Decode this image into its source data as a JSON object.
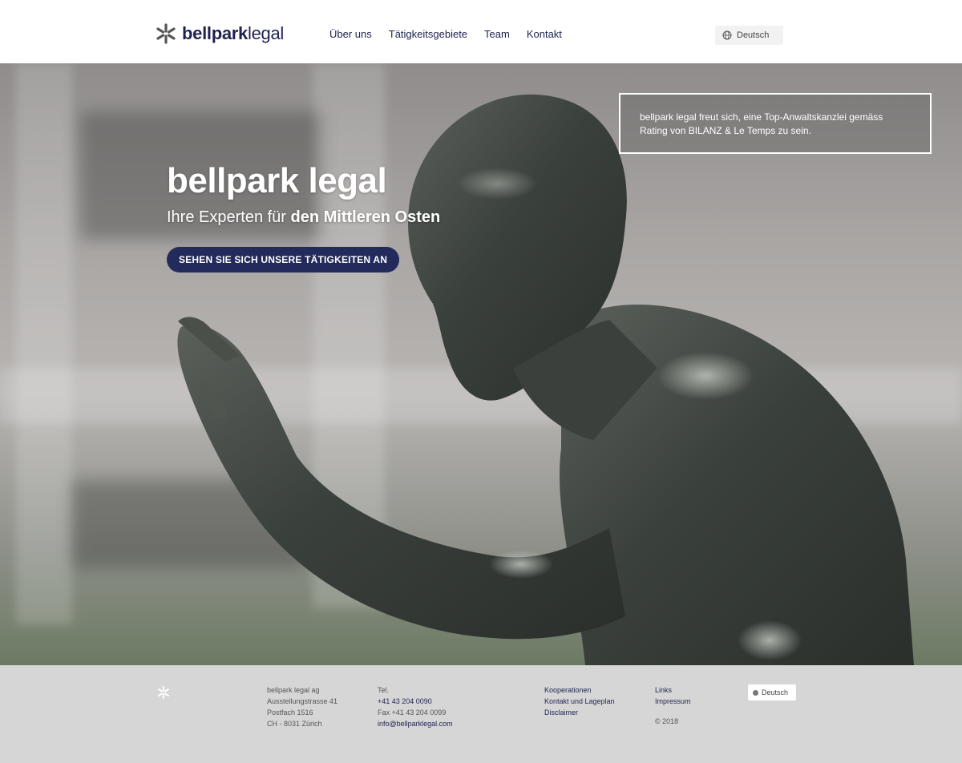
{
  "header": {
    "logo_bold": "bellpark",
    "logo_light": "legal",
    "nav": [
      "Über uns",
      "Tätigkeitsgebiete",
      "Team",
      "Kontakt"
    ],
    "language": "Deutsch"
  },
  "hero": {
    "title": "bellpark legal",
    "subtitle_prefix": "Ihre Experten für ",
    "subtitle_bold": "den Mittleren Osten",
    "cta": "SEHEN SIE SICH UNSERE TÄTIGKEITEN AN",
    "notice": "bellpark legal freut sich, eine Top-Anwaltskanzlei gemäss Rating von BILANZ & Le Temps zu sein."
  },
  "footer": {
    "address": [
      "bellpark legal ag",
      "Ausstellungstrasse 41",
      "Postfach 1516",
      "CH - 8031 Zürich"
    ],
    "tel_label": "Tel. ",
    "tel": "+41 43 204 0090",
    "fax": "Fax +41 43 204 0099",
    "email": "info@bellparklegal.com",
    "links_col1": [
      "Kooperationen",
      "Kontakt und Lageplan",
      "Disclaimer"
    ],
    "links_col2": [
      "Links",
      "Impressum"
    ],
    "copyright": "© 2018",
    "language": "Deutsch"
  },
  "colors": {
    "brand_navy": "#1f2250",
    "cta_bg": "#232a5c",
    "footer_bg": "#d6d6d6"
  }
}
